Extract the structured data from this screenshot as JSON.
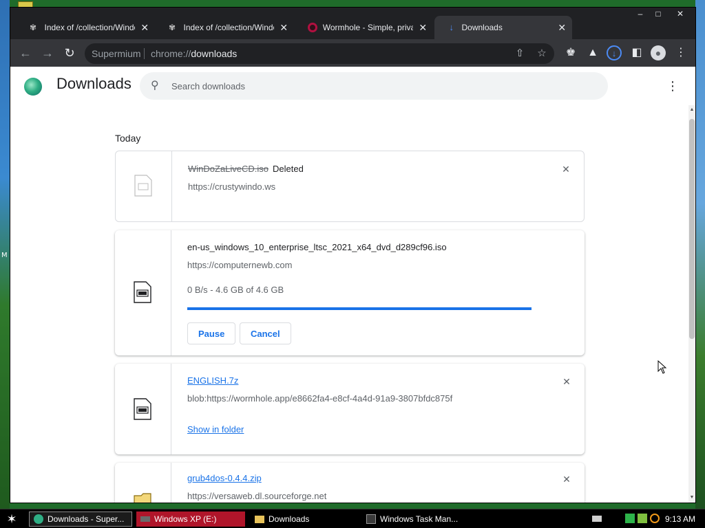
{
  "tabs": [
    {
      "title": "Index of /collection/Window",
      "icon": "folder-icon",
      "active": false
    },
    {
      "title": "Index of /collection/Window",
      "icon": "folder-icon",
      "active": false
    },
    {
      "title": "Wormhole - Simple, private",
      "icon": "wormhole-icon",
      "active": false
    },
    {
      "title": "Downloads",
      "icon": "download-icon",
      "active": true
    }
  ],
  "window_controls": {
    "minimize": "–",
    "maximize": "□",
    "close": "✕"
  },
  "toolbar": {
    "brand": "Supermium",
    "url_scheme": "chrome://",
    "url_path": "downloads"
  },
  "page": {
    "title": "Downloads",
    "search_placeholder": "Search downloads",
    "section_label": "Today"
  },
  "downloads": [
    {
      "name": "WinDoZaLiveCD.iso",
      "state": "Deleted",
      "source": "https://crustywindo.ws"
    },
    {
      "name": "en-us_windows_10_enterprise_ltsc_2021_x64_dvd_d289cf96.iso",
      "source": "https://computernewb.com",
      "progress_text": "0 B/s - 4.6 GB of 4.6 GB",
      "progress": 1.0,
      "pause_label": "Pause",
      "cancel_label": "Cancel"
    },
    {
      "name": "ENGLISH.7z",
      "source": "blob:https://wormhole.app/e8662fa4-e8cf-4a4d-91a9-3807bfdc875f",
      "action_label": "Show in folder"
    },
    {
      "name": "grub4dos-0.4.4.zip",
      "source": "https://versaweb.dl.sourceforge.net"
    }
  ],
  "taskbar": {
    "tasks": [
      {
        "label": "Downloads - Super...",
        "icon": "supermium-icon",
        "style": "active"
      },
      {
        "label": "Windows XP (E:)",
        "icon": "drive-icon",
        "style": "hilite"
      },
      {
        "label": "Downloads",
        "icon": "folder-icon",
        "style": "normal"
      },
      {
        "label": "Windows Task Man...",
        "icon": "task-manager-icon",
        "style": "normal"
      }
    ],
    "clock": "9:13 AM"
  },
  "colors": {
    "accent": "#1a73e8",
    "chrome_dark": "#202124",
    "toolbar": "#35363a",
    "taskbar": "#000000"
  },
  "desktop": {
    "edge_label": "M"
  }
}
